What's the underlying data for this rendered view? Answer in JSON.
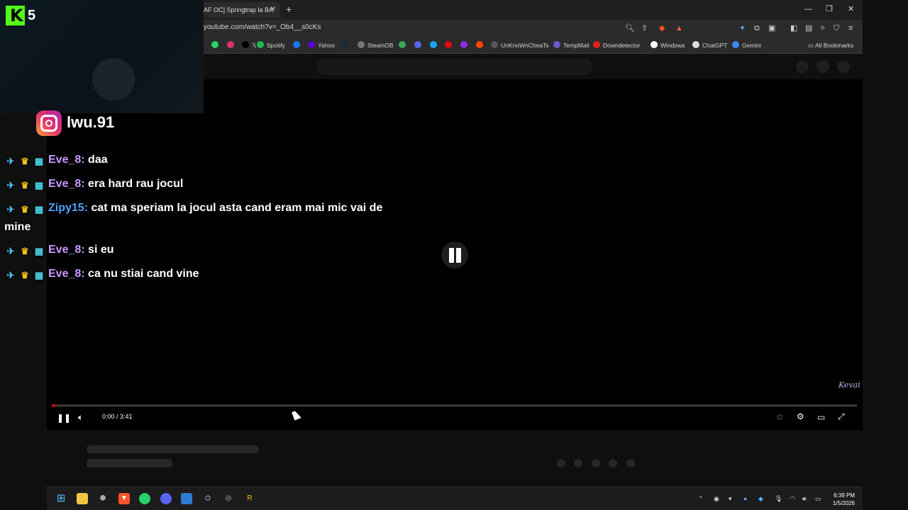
{
  "browser": {
    "tab_title": "AF OC] Springtrap la BA",
    "tab_close": "✕",
    "new_tab": "+",
    "window_controls": {
      "minimize": "—",
      "restore": "❐",
      "close": "✕"
    },
    "url": "youtube.com/watch?v=_Ob4__s0cKs",
    "bookmarks": [
      {
        "label": "",
        "color": "#25d366"
      },
      {
        "label": "",
        "color": "#e1306c"
      },
      {
        "label": "𝕏",
        "color": "#000000"
      },
      {
        "label": "Spotify",
        "color": "#1db954"
      },
      {
        "label": "",
        "color": "#1877f2"
      },
      {
        "label": "Yahoo",
        "color": "#5f01d1"
      },
      {
        "label": "",
        "color": "#1b2838"
      },
      {
        "label": "SteamDB",
        "color": "#777777"
      },
      {
        "label": "",
        "color": "#3aa757"
      },
      {
        "label": "",
        "color": "#5865f2"
      },
      {
        "label": "",
        "color": "#1da1f2"
      },
      {
        "label": "",
        "color": "#e50914"
      },
      {
        "label": "",
        "color": "#8e2de2"
      },
      {
        "label": "",
        "color": "#ff4500"
      },
      {
        "label": "UnKnoWnCheaTs",
        "color": "#555555"
      },
      {
        "label": "TempMail",
        "color": "#6a5acd"
      },
      {
        "label": "Downdetector",
        "color": "#e01e1e"
      },
      {
        "label": "Windows",
        "color": "#ffffff"
      },
      {
        "label": "ChatGPT",
        "color": "#dddddd"
      },
      {
        "label": "Gemini",
        "color": "#4285f4"
      }
    ],
    "all_bookmarks": "All Bookmarks"
  },
  "player": {
    "time": "0:00 / 3:41",
    "progress": 0.004,
    "watermark": "Kevai"
  },
  "overlay": {
    "kick_count": "5",
    "kick_letter": "K",
    "instagram_handle": "lwu.91",
    "chat": [
      {
        "user": "Eve_8:",
        "message": "daa",
        "color": "purple"
      },
      {
        "user": "Eve_8:",
        "message": "era hard rau jocul",
        "color": "purple"
      },
      {
        "user": "Zipy15:",
        "message": "cat ma speriam la jocul asta cand eram mai mic vai de mine",
        "color": "blue"
      },
      {
        "user": "Eve_8:",
        "message": "si eu",
        "color": "purple"
      },
      {
        "user": "Eve_8:",
        "message": "ca nu stiai cand vine",
        "color": "purple"
      }
    ]
  },
  "taskbar": {
    "clock_time": "6:39 PM",
    "clock_date": "1/5/2026"
  }
}
